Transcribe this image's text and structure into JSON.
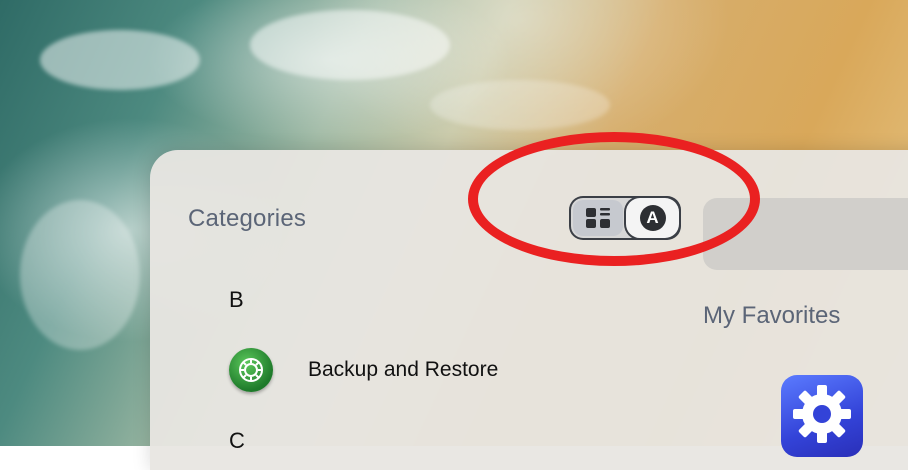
{
  "categories_title": "Categories",
  "view_toggle": {
    "left_icon": "grid-list-icon",
    "right_icon": "alphabet-a-icon",
    "right_letter": "A",
    "selected": "alphabetical"
  },
  "sections": [
    {
      "letter": "B",
      "apps": [
        {
          "label": "Backup and Restore",
          "icon": "backup-restore-icon"
        }
      ]
    },
    {
      "letter": "C",
      "apps": []
    }
  ],
  "favorites_title": "My Favorites",
  "favorites": [
    {
      "icon": "settings-gear-icon"
    }
  ],
  "colors": {
    "panel": "#E8E6E2",
    "heading_text": "#5B6577",
    "annotation": "#EA2121",
    "settings_tile": "#3343D8",
    "backup_icon": "#2E8B3A"
  }
}
